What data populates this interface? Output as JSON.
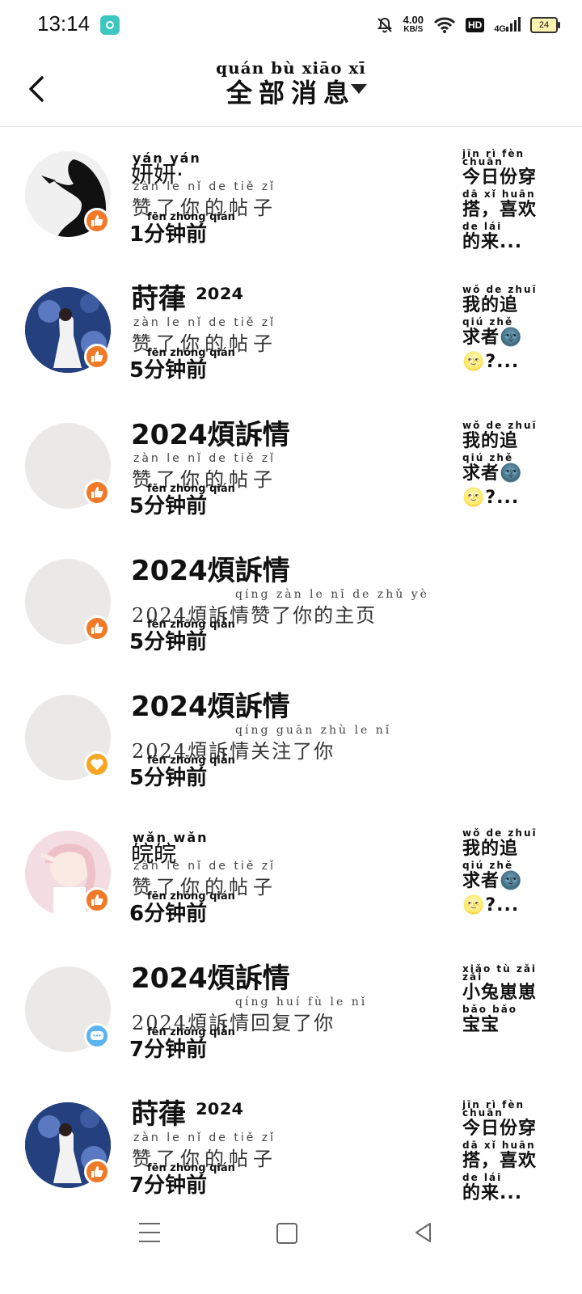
{
  "status_bar": {
    "time": "13:14",
    "speed_value": "4.00",
    "speed_unit": "KB/S",
    "hd": "HD",
    "network": "4G",
    "battery": "24"
  },
  "header": {
    "title_pinyin": "quán bù xiāo xī",
    "title": "全部消息"
  },
  "messages": [
    {
      "name_pinyin": "yán yán",
      "name": "妍妍·",
      "action_pinyin": "zàn le nǐ de tiě zǐ",
      "action": "赞了你的帖子",
      "time_pinyin": "fēn zhōng qián",
      "time": "1分钟前",
      "badge": "like",
      "preview_lines": [
        {
          "py": "jīn rì fèn chuān",
          "zh": "今日份穿"
        },
        {
          "py": "dā    xǐ huān",
          "zh": "搭，喜欢"
        },
        {
          "py": "de lái",
          "zh": "的来..."
        }
      ]
    },
    {
      "name_pinyin": "",
      "name": "莳葎 ²⁰²⁴",
      "action_pinyin": "zàn le nǐ de tiě zǐ",
      "action": "赞了你的帖子",
      "time_pinyin": "fēn zhōng qián",
      "time": "5分钟前",
      "badge": "like",
      "preview_lines": [
        {
          "py": "wǒ de zhuī",
          "zh": "我的追"
        },
        {
          "py": "qiú zhě",
          "zh": "求者🌚"
        },
        {
          "py": "",
          "zh": "🌝?..."
        }
      ]
    },
    {
      "name_pinyin": "",
      "name": "2024煩訴情",
      "action_pinyin": "zàn le nǐ de tiě zǐ",
      "action": "赞了你的帖子",
      "time_pinyin": "fēn zhōng qián",
      "time": "5分钟前",
      "badge": "like",
      "preview_lines": [
        {
          "py": "wǒ de zhuī",
          "zh": "我的追"
        },
        {
          "py": "qiú zhě",
          "zh": "求者🌚"
        },
        {
          "py": "",
          "zh": "🌝?..."
        }
      ]
    },
    {
      "name_pinyin": "",
      "name": "2024煩訴情",
      "action_pinyin": "qíng zàn le nǐ de zhǔ yè",
      "action": "2024煩訴情赞了你的主页",
      "time_pinyin": "fēn zhōng qián",
      "time": "5分钟前",
      "badge": "like",
      "preview_lines": []
    },
    {
      "name_pinyin": "",
      "name": "2024煩訴情",
      "action_pinyin": "qíng guān zhù le nǐ",
      "action": "2024煩訴情关注了你",
      "time_pinyin": "fēn zhōng qián",
      "time": "5分钟前",
      "badge": "follow",
      "preview_lines": []
    },
    {
      "name_pinyin": "wǎn wǎn",
      "name": "皖皖",
      "action_pinyin": "zàn le nǐ de tiě zǐ",
      "action": "赞了你的帖子",
      "time_pinyin": "fēn zhōng qián",
      "time": "6分钟前",
      "badge": "like",
      "preview_lines": [
        {
          "py": "wǒ de zhuī",
          "zh": "我的追"
        },
        {
          "py": "qiú zhě",
          "zh": "求者🌚"
        },
        {
          "py": "",
          "zh": "🌝?..."
        }
      ]
    },
    {
      "name_pinyin": "",
      "name": "2024煩訴情",
      "action_pinyin": "qíng huí fù le nǐ",
      "action": "2024煩訴情回复了你",
      "time_pinyin": "fēn zhōng qián",
      "time": "7分钟前",
      "badge": "comment",
      "preview_lines": [
        {
          "py": "xiǎo tù zǎi zǎi",
          "zh": "小兔崽崽"
        },
        {
          "py": "bǎo bǎo",
          "zh": "宝宝"
        }
      ]
    },
    {
      "name_pinyin": "",
      "name": "莳葎 ²⁰²⁴",
      "action_pinyin": "zàn le nǐ de tiě zǐ",
      "action": "赞了你的帖子",
      "time_pinyin": "fēn zhōng qián",
      "time": "7分钟前",
      "badge": "like",
      "preview_lines": [
        {
          "py": "jīn rì fèn chuān",
          "zh": "今日份穿"
        },
        {
          "py": "dā    xǐ huān",
          "zh": "搭，喜欢"
        },
        {
          "py": "de lái",
          "zh": "的来..."
        }
      ]
    }
  ]
}
